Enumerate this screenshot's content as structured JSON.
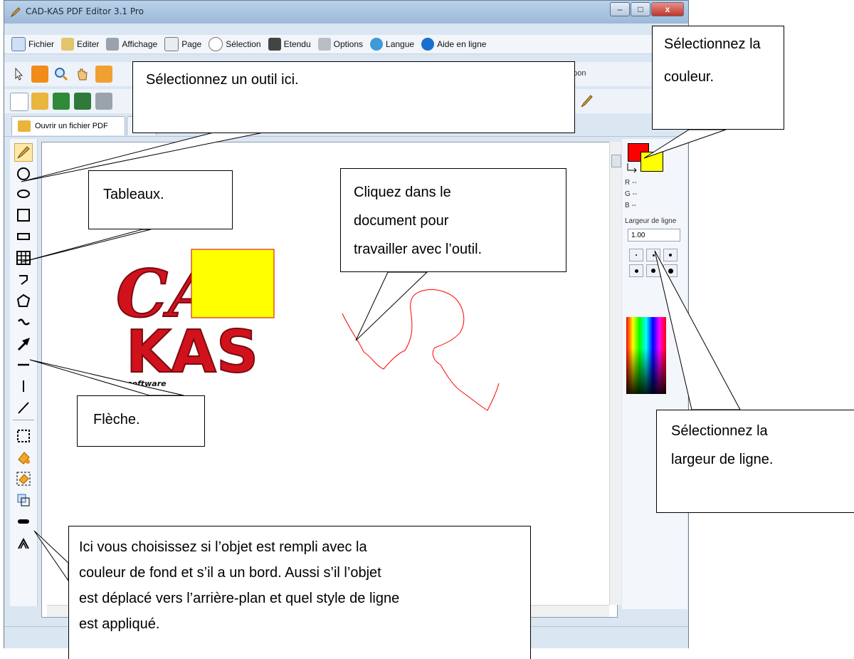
{
  "window": {
    "title": "CAD-KAS PDF Editor 3.1 Pro",
    "controls": {
      "minimize": "–",
      "maximize": "□",
      "close": "x"
    }
  },
  "menu": {
    "items": [
      "Fichier",
      "Editer",
      "Affichage",
      "Page",
      "Sélection",
      "Etendu",
      "Options",
      "Langue",
      "Aide en ligne"
    ]
  },
  "toolbar": {
    "stamp_label_partial": "mpon"
  },
  "tabs": {
    "open_pdf": "Ouvrir un fichier PDF"
  },
  "right_panel": {
    "r_label": "R --",
    "g_label": "G --",
    "b_label": "B --",
    "line_width_label": "Largeur de ligne",
    "line_width_value": "1.00",
    "foreground_color": "#ff0000",
    "background_color": "#ffff00"
  },
  "document": {
    "logo_text_line1": "CAD",
    "logo_text_line2": "KAS",
    "logo_subtext": "software",
    "rect_fill": "#ffff00",
    "rect_stroke": "#cc0000",
    "stroke_color": "#ff0000"
  },
  "callouts": {
    "tool": "Sélectionnez un outil ici.",
    "color_line1": "Sélectionnez la",
    "color_line2": "couleur.",
    "tables": "Tableaux.",
    "click_line1": "Cliquez dans le",
    "click_line2": "document pour",
    "click_line3": "travailler avec l’outil.",
    "arrow": "Flèche.",
    "width_line1": "Sélectionnez la",
    "width_line2": "largeur de ligne.",
    "fill_line1": "Ici vous choisissez si l’objet est rempli avec la",
    "fill_line2": "couleur de fond et s’il a un bord. Aussi s’il l’objet",
    "fill_line3": "est déplacé vers l’arrière-plan et quel style de ligne",
    "fill_line4": "est appliqué."
  },
  "icons": [
    "app-pencil-icon",
    "brush-icon",
    "circle-icon",
    "ellipse-icon",
    "square-icon",
    "rectangle-icon",
    "table-icon",
    "polyline-icon",
    "polygon-icon",
    "curve-icon",
    "arrow-icon",
    "horizontal-line-icon",
    "vertical-line-icon",
    "diagonal-line-icon",
    "selection-icon",
    "fill-icon",
    "fill-border-icon",
    "background-order-icon",
    "line-style-icon",
    "chevron-up-icon"
  ]
}
